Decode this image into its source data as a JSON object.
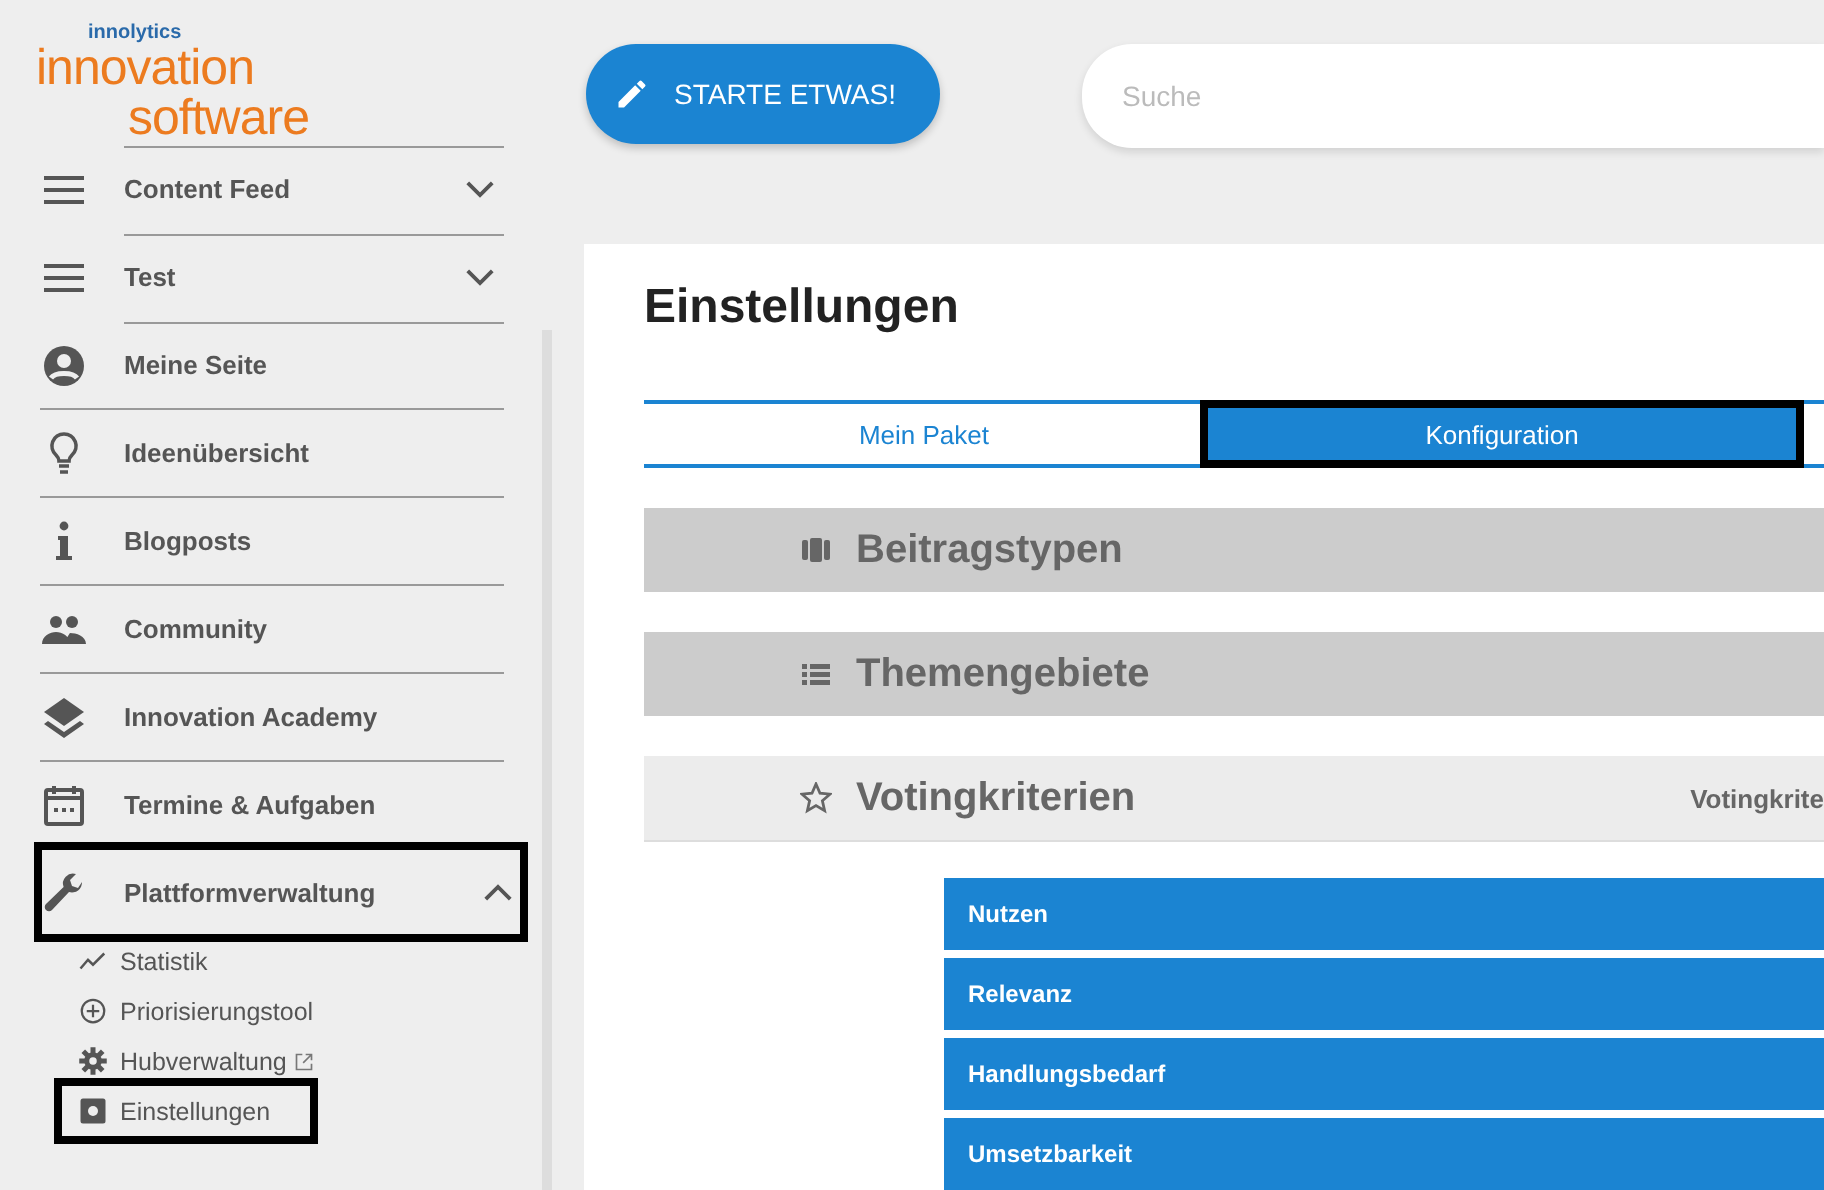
{
  "logo": {
    "brand": "innolytics",
    "line1": "innovation",
    "line2": "software"
  },
  "sidebar": {
    "items": [
      {
        "label": "Content Feed",
        "expanded": false,
        "highlighted": false
      },
      {
        "label": "Test",
        "expanded": false,
        "highlighted": false
      },
      {
        "label": "Meine Seite",
        "highlighted": false
      },
      {
        "label": "Ideenübersicht",
        "highlighted": false
      },
      {
        "label": "Blogposts",
        "highlighted": false
      },
      {
        "label": "Community",
        "highlighted": false
      },
      {
        "label": "Innovation Academy",
        "highlighted": false
      },
      {
        "label": "Termine & Aufgaben",
        "highlighted": false
      },
      {
        "label": "Plattformverwaltung",
        "expanded": true,
        "highlighted": true,
        "children": [
          {
            "label": "Statistik",
            "external": false,
            "highlighted": false
          },
          {
            "label": "Priorisierungstool",
            "external": false,
            "highlighted": false
          },
          {
            "label": "Hubverwaltung",
            "external": true,
            "highlighted": false
          },
          {
            "label": "Einstellungen",
            "external": false,
            "highlighted": true
          }
        ]
      }
    ]
  },
  "start_button": "STARTE ETWAS!",
  "search": {
    "placeholder": "Suche"
  },
  "page": {
    "title": "Einstellungen",
    "tabs": [
      {
        "label": "Mein Paket",
        "selected": false,
        "highlighted": false
      },
      {
        "label": "Konfiguration",
        "selected": true,
        "highlighted": true
      }
    ],
    "sections": [
      {
        "title": "Beitragstypen",
        "expanded": false
      },
      {
        "title": "Themengebiete",
        "expanded": false
      },
      {
        "title": "Votingkriterien",
        "expanded": true,
        "side_label": "Votingkrite",
        "criteria": [
          "Nutzen",
          "Relevanz",
          "Handlungsbedarf",
          "Umsetzbarkeit"
        ]
      }
    ]
  }
}
